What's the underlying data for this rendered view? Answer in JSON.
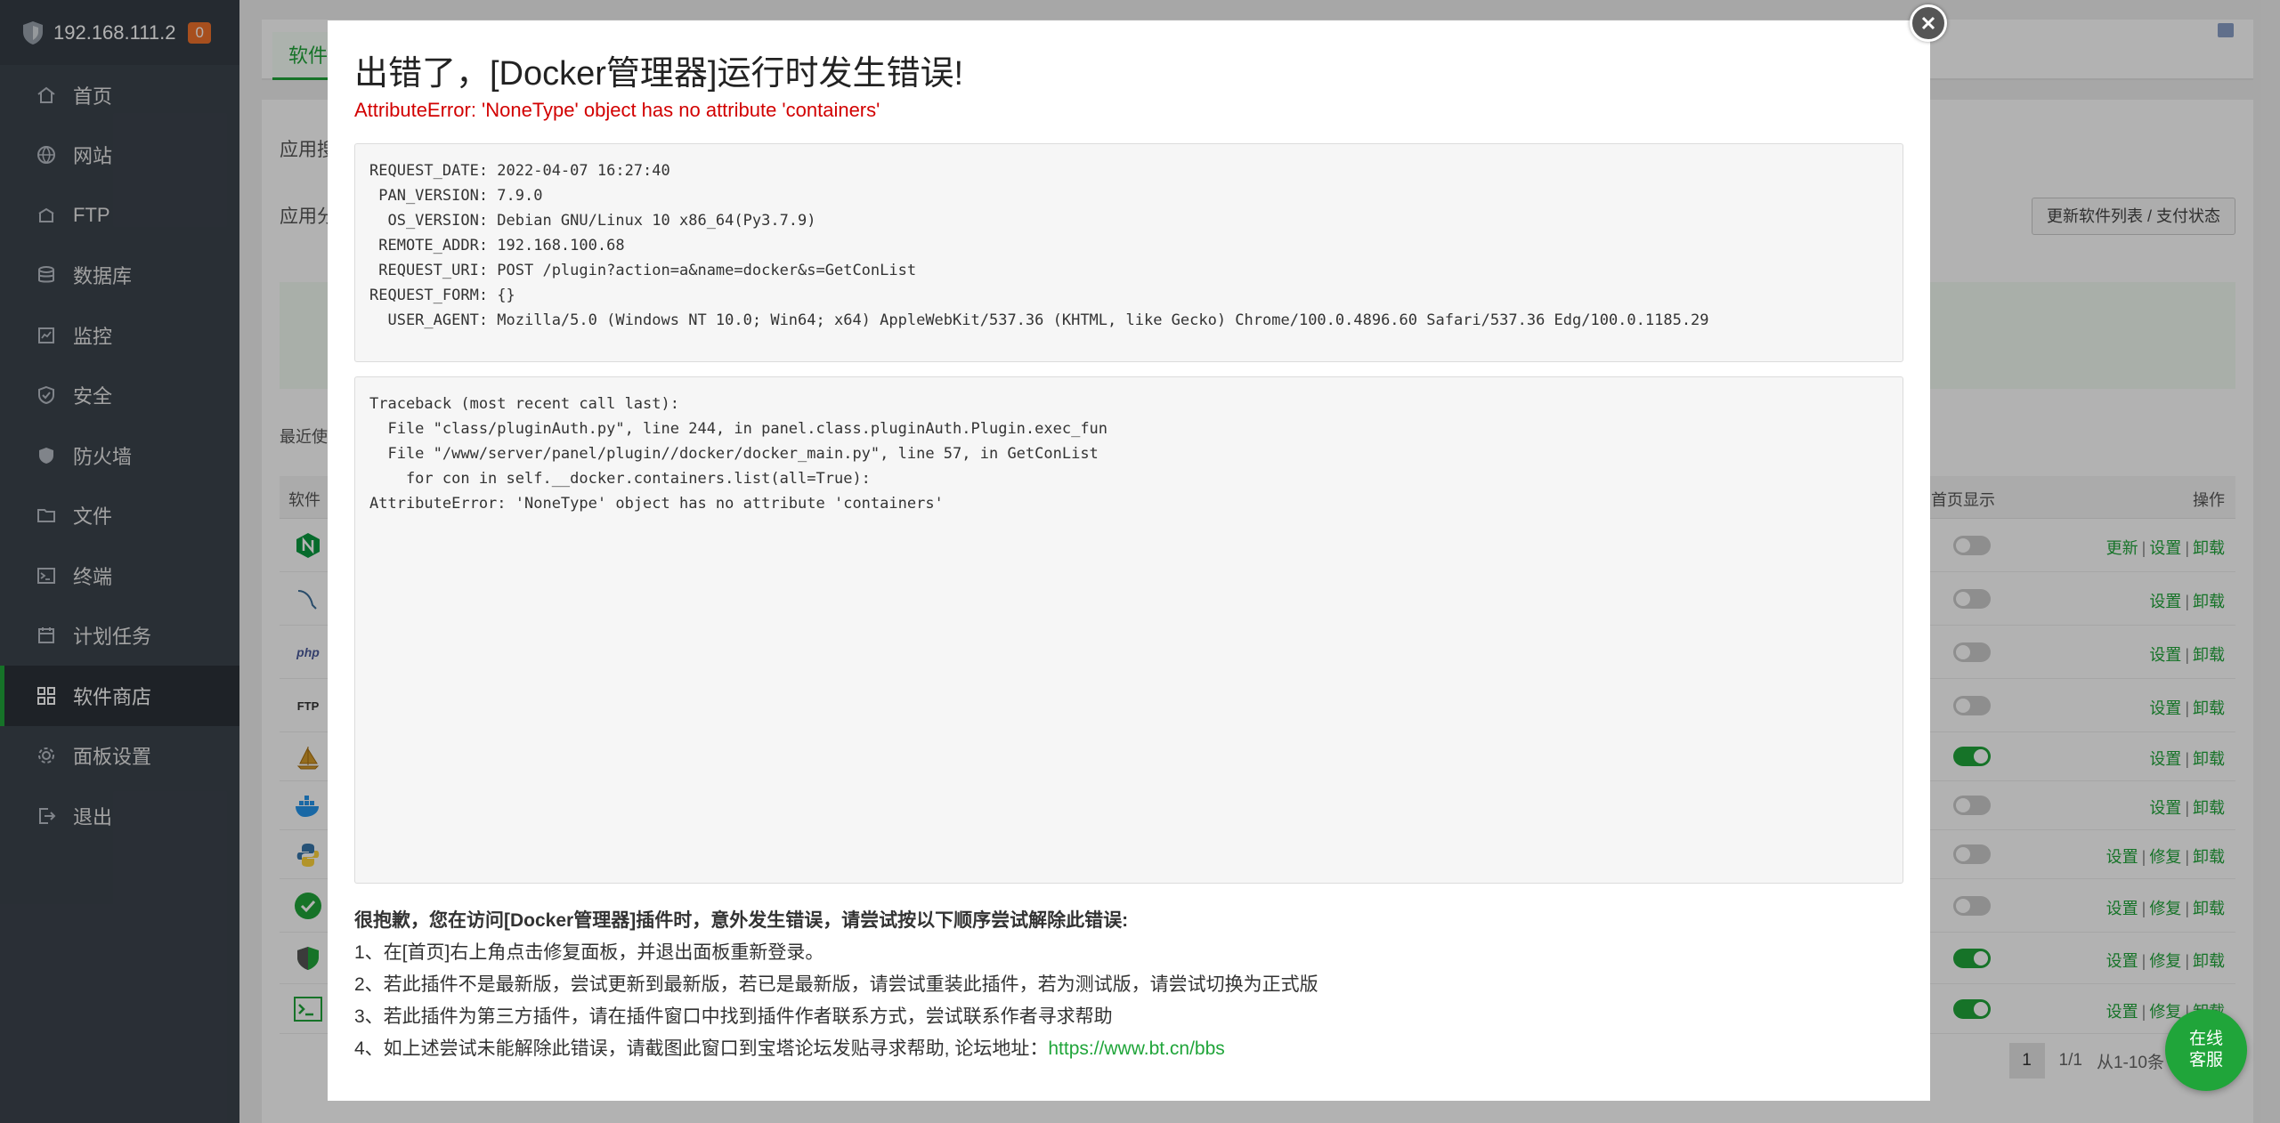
{
  "sidebar": {
    "server_ip": "192.168.111.2",
    "badge_count": "0",
    "items": [
      {
        "label": "首页",
        "icon": "home-icon"
      },
      {
        "label": "网站",
        "icon": "globe-icon"
      },
      {
        "label": "FTP",
        "icon": "ftp-icon"
      },
      {
        "label": "数据库",
        "icon": "database-icon"
      },
      {
        "label": "监控",
        "icon": "monitor-icon"
      },
      {
        "label": "安全",
        "icon": "shield-check-icon"
      },
      {
        "label": "防火墙",
        "icon": "firewall-icon"
      },
      {
        "label": "文件",
        "icon": "folder-icon"
      },
      {
        "label": "终端",
        "icon": "terminal-icon"
      },
      {
        "label": "计划任务",
        "icon": "calendar-icon"
      },
      {
        "label": "软件商店",
        "icon": "grid-icon",
        "active": true
      },
      {
        "label": "面板设置",
        "icon": "gear-icon"
      },
      {
        "label": "退出",
        "icon": "logout-icon"
      }
    ]
  },
  "main": {
    "tab_active": "软件",
    "row1_label": "应用搜",
    "row2_label": "应用分",
    "refresh_button": "更新软件列表 / 支付状态",
    "recent_label": "最近使",
    "table": {
      "col_software": "软件",
      "col_home": "首页显示",
      "col_ops": "操作",
      "rows": [
        {
          "icon": "nginx-icon",
          "home": false,
          "ops": [
            "更新",
            "设置",
            "卸载"
          ]
        },
        {
          "icon": "mysql-icon",
          "home": false,
          "ops": [
            "设置",
            "卸载"
          ]
        },
        {
          "icon": "php-icon",
          "home": false,
          "ops": [
            "设置",
            "卸载"
          ]
        },
        {
          "icon": "ftp-app-icon",
          "home": false,
          "ops": [
            "设置",
            "卸载"
          ]
        },
        {
          "icon": "sailboat-icon",
          "home": true,
          "ops": [
            "设置",
            "卸载"
          ]
        },
        {
          "icon": "docker-icon",
          "home": false,
          "ops": [
            "设置",
            "卸载"
          ]
        },
        {
          "icon": "python-icon",
          "home": false,
          "ops": [
            "设置",
            "修复",
            "卸载"
          ]
        },
        {
          "icon": "check-app-icon",
          "home": false,
          "ops": [
            "设置",
            "修复",
            "卸载"
          ]
        },
        {
          "icon": "shield-app-icon",
          "home": true,
          "ops": [
            "设置",
            "修复",
            "卸载"
          ]
        },
        {
          "icon": "terminal-app-icon",
          "home": true,
          "ops": [
            "设置",
            "修复",
            "卸载"
          ]
        }
      ]
    },
    "pager": {
      "current": "1",
      "total": "1/1",
      "range": "从1-10条"
    }
  },
  "modal": {
    "title": "出错了，[Docker管理器]运行时发生错误!",
    "error": "AttributeError: 'NoneType' object has no attribute 'containers'",
    "request_info": "REQUEST_DATE: 2022-04-07 16:27:40\n PAN_VERSION: 7.9.0\n  OS_VERSION: Debian GNU/Linux 10 x86_64(Py3.7.9)\n REMOTE_ADDR: 192.168.100.68\n REQUEST_URI: POST /plugin?action=a&name=docker&s=GetConList\nREQUEST_FORM: {}\n  USER_AGENT: Mozilla/5.0 (Windows NT 10.0; Win64; x64) AppleWebKit/537.36 (KHTML, like Gecko) Chrome/100.0.4896.60 Safari/537.36 Edg/100.0.1185.29",
    "traceback": "Traceback (most recent call last):\n  File \"class/pluginAuth.py\", line 244, in panel.class.pluginAuth.Plugin.exec_fun\n  File \"/www/server/panel/plugin//docker/docker_main.py\", line 57, in GetConList\n    for con in self.__docker.containers.list(all=True):\nAttributeError: 'NoneType' object has no attribute 'containers'",
    "help_head": "很抱歉，您在访问[Docker管理器]插件时，意外发生错误，请尝试按以下顺序尝试解除此错误:",
    "help_1": "1、在[首页]右上角点击修复面板，并退出面板重新登录。",
    "help_2": "2、若此插件不是最新版，尝试更新到最新版，若已是最新版，请尝试重装此插件，若为测试版，请尝试切换为正式版",
    "help_3": "3、若此插件为第三方插件，请在插件窗口中找到插件作者联系方式，尝试联系作者寻求帮助",
    "help_4": "4、如上述尝试未能解除此错误，请截图此窗口到宝塔论坛发贴寻求帮助, 论坛地址：",
    "forum_link": "https://www.bt.cn/bbs"
  },
  "service": {
    "line1": "在线",
    "line2": "客服"
  },
  "colors": {
    "accent": "#20a53a",
    "error": "#d20000",
    "sidebar": "#3c444d"
  }
}
